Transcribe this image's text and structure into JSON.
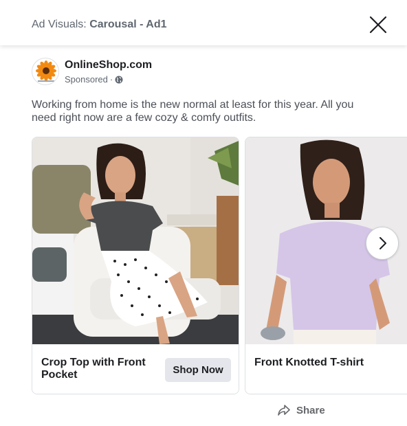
{
  "header": {
    "prefix": "Ad Visuals: ",
    "ad_name": "Carousal - Ad1"
  },
  "post": {
    "page_name": "OnlineShop.com",
    "sponsored": "Sponsored",
    "separator": "·",
    "text": "Working from home is the new normal at least for this year. All you need right now are a few cozy & comfy outfits."
  },
  "cards": [
    {
      "title": "Crop Top with Front Pocket",
      "cta": "Shop Now"
    },
    {
      "title": "Front Knotted T-shirt"
    }
  ],
  "actions": {
    "share": "Share"
  },
  "icons": {
    "close": "close-icon",
    "globe": "globe-icon",
    "next": "chevron-right-icon",
    "share": "share-arrow-icon"
  },
  "colors": {
    "header_text": "#606770",
    "button_bg": "#e4e6eb",
    "card_border": "#dddfe2",
    "top1": "#4a4c4e",
    "top2": "#d5c6e8"
  }
}
